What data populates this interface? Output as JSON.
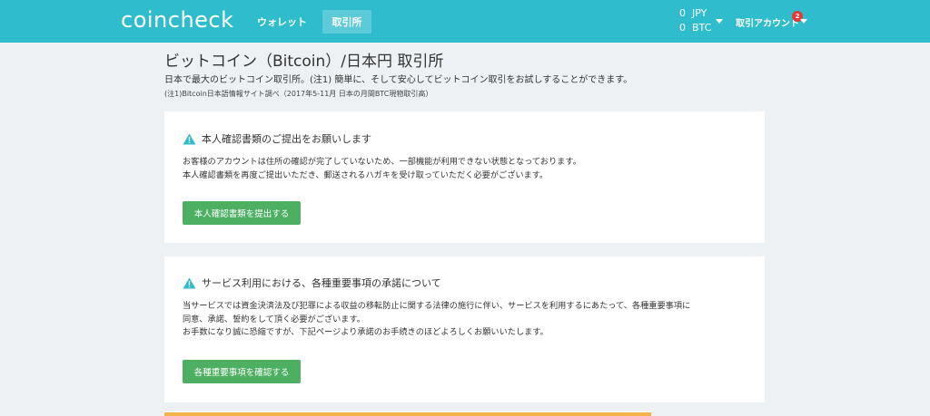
{
  "header": {
    "logo": "coincheck",
    "nav_wallet": "ウォレット",
    "nav_exchange": "取引所",
    "balance": [
      {
        "amount": "0",
        "currency": "JPY"
      },
      {
        "amount": "0",
        "currency": "BTC"
      }
    ],
    "account_label": "取引アカウント",
    "notification_count": "2",
    "brand_color": "#2fbccd"
  },
  "page": {
    "title": "ビットコイン（Bitcoin）/日本円 取引所",
    "subtitle": "日本で最大のビットコイン取引所。(注1) 簡単に、そして安心してビットコイン取引をお試しすることができます。",
    "note": "(注1)Bitcoin日本語情報サイト調べ（2017年5-11月 日本の月間BTC現物取引高）"
  },
  "cards": [
    {
      "icon": "warning-icon",
      "heading": "本人確認書類のご提出をお願いします",
      "lines": [
        "お客様のアカウントは住所の確認が完了していないため、一部機能が利用できない状態となっております。",
        "本人確認書類を再度ご提出いただき、郵送されるハガキを受け取っていただく必要がございます。"
      ],
      "button": "本人確認書類を提出する"
    },
    {
      "icon": "warning-icon",
      "heading": "サービス利用における、各種重要事項の承諾について",
      "lines": [
        "当サービスでは資金決済法及び犯罪による収益の移転防止に関する法律の施行に伴い、サービスを利用するにあたって、各種重要事項に",
        "同意、承諾、誓約をして頂く必要がございます。",
        "お手数になり誠に恐縮ですが、下記ページより承諾のお手続きのほどよろしくお願いいたします。"
      ],
      "button": "各種重要事項を確認する"
    }
  ],
  "colors": {
    "button_green": "#4caf62",
    "warning_teal": "#2fbccd",
    "badge_red": "#e53935"
  }
}
